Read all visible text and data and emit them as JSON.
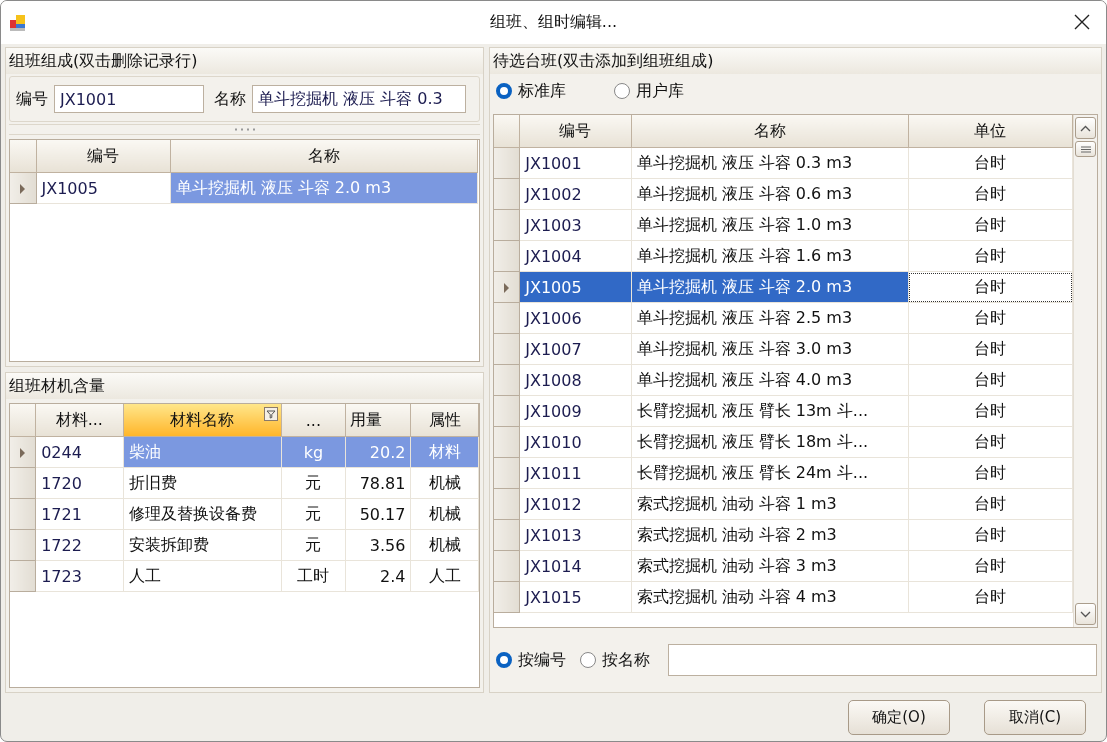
{
  "window": {
    "title": "组班、组时编辑..."
  },
  "composition": {
    "title": "组班组成(双击删除记录行)",
    "code_label": "编号",
    "code_value": "JX1001",
    "name_label": "名称",
    "name_value": "单斗挖掘机 液压 斗容 0.3",
    "grid": {
      "focused": false,
      "columns": [
        {
          "label": "编号",
          "kind": "text",
          "selected": false,
          "active": false
        },
        {
          "label": "名称",
          "kind": "text",
          "selected": true,
          "active": false
        }
      ],
      "rows": [
        {
          "cells": [
            "JX1005",
            "单斗挖掘机 液压 斗容 2.0 m3"
          ],
          "selected": true
        }
      ]
    }
  },
  "materials": {
    "title": "组班材机含量",
    "grid": {
      "focused": false,
      "columns": [
        {
          "label": "材料...",
          "kind": "text",
          "selected": false,
          "active": false
        },
        {
          "label": "材料名称",
          "kind": "text",
          "selected": true,
          "active": true
        },
        {
          "label": "...",
          "kind": "center",
          "selected": true,
          "active": false
        },
        {
          "label": "用量",
          "kind": "number",
          "selected": true,
          "active": false
        },
        {
          "label": "属性",
          "kind": "center",
          "selected": true,
          "active": false
        }
      ],
      "rows": [
        {
          "cells": [
            "0244",
            "柴油",
            "kg",
            "20.2",
            "材料"
          ],
          "selected": true
        },
        {
          "cells": [
            "1720",
            "折旧费",
            "元",
            "78.81",
            "机械"
          ],
          "selected": false
        },
        {
          "cells": [
            "1721",
            "修理及替换设备费",
            "元",
            "50.17",
            "机械"
          ],
          "selected": false
        },
        {
          "cells": [
            "1722",
            "安装拆卸费",
            "元",
            "3.56",
            "机械"
          ],
          "selected": false
        },
        {
          "cells": [
            "1723",
            "人工",
            "工时",
            "2.4",
            "人工"
          ],
          "selected": false
        }
      ]
    }
  },
  "candidates": {
    "title": "待选台班(双击添加到组班组成)",
    "library_options": [
      {
        "label": "标准库",
        "selected": true
      },
      {
        "label": "用户库",
        "selected": false
      }
    ],
    "grid": {
      "focused": true,
      "columns": [
        {
          "label": "编号",
          "kind": "text",
          "selected": true,
          "active": false
        },
        {
          "label": "名称",
          "kind": "text",
          "selected": true,
          "active": false
        },
        {
          "label": "单位",
          "kind": "center",
          "selected": false,
          "active": false
        }
      ],
      "rows": [
        {
          "cells": [
            "JX1001",
            "单斗挖掘机 液压 斗容 0.3 m3",
            "台时"
          ],
          "selected": false
        },
        {
          "cells": [
            "JX1002",
            "单斗挖掘机 液压 斗容 0.6 m3",
            "台时"
          ],
          "selected": false
        },
        {
          "cells": [
            "JX1003",
            "单斗挖掘机 液压 斗容 1.0 m3",
            "台时"
          ],
          "selected": false
        },
        {
          "cells": [
            "JX1004",
            "单斗挖掘机 液压 斗容 1.6 m3",
            "台时"
          ],
          "selected": false
        },
        {
          "cells": [
            "JX1005",
            "单斗挖掘机 液压 斗容 2.0 m3",
            "台时"
          ],
          "selected": true
        },
        {
          "cells": [
            "JX1006",
            "单斗挖掘机 液压 斗容 2.5 m3",
            "台时"
          ],
          "selected": false
        },
        {
          "cells": [
            "JX1007",
            "单斗挖掘机 液压 斗容 3.0 m3",
            "台时"
          ],
          "selected": false
        },
        {
          "cells": [
            "JX1008",
            "单斗挖掘机 液压 斗容 4.0 m3",
            "台时"
          ],
          "selected": false
        },
        {
          "cells": [
            "JX1009",
            "长臂挖掘机 液压 臂长 13m 斗...",
            "台时"
          ],
          "selected": false
        },
        {
          "cells": [
            "JX1010",
            "长臂挖掘机 液压 臂长 18m 斗...",
            "台时"
          ],
          "selected": false
        },
        {
          "cells": [
            "JX1011",
            "长臂挖掘机 液压 臂长 24m 斗...",
            "台时"
          ],
          "selected": false
        },
        {
          "cells": [
            "JX1012",
            "索式挖掘机 油动 斗容 1 m3",
            "台时"
          ],
          "selected": false
        },
        {
          "cells": [
            "JX1013",
            "索式挖掘机 油动 斗容 2 m3",
            "台时"
          ],
          "selected": false
        },
        {
          "cells": [
            "JX1014",
            "索式挖掘机 油动 斗容 3 m3",
            "台时"
          ],
          "selected": false
        },
        {
          "cells": [
            "JX1015",
            "索式挖掘机 油动 斗容 4 m3",
            "台时"
          ],
          "selected": false
        }
      ]
    },
    "search_options": [
      {
        "label": "按编号",
        "selected": true
      },
      {
        "label": "按名称",
        "selected": false
      }
    ]
  },
  "buttons": [
    {
      "label": "确定(O)"
    },
    {
      "label": "取消(C)"
    }
  ]
}
